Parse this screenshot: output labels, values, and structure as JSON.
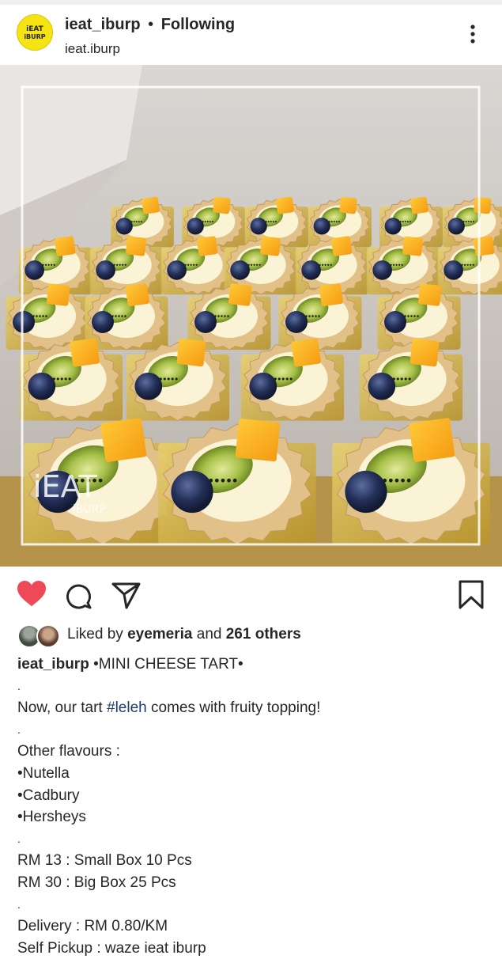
{
  "header": {
    "username": "ieat_iburp",
    "separator": "•",
    "follow_status": "Following",
    "location": "ieat.iburp",
    "avatar_text_line1": "iEAT",
    "avatar_text_line2": "iBURP"
  },
  "photo": {
    "watermark_line1": "iEAT",
    "watermark_line2": "iBURP"
  },
  "actions": {
    "liked": true,
    "like_color": "#ed4956"
  },
  "likes": {
    "prefix": "Liked by",
    "first_liker": "eyemeria",
    "conjunction": "and",
    "others": "261 others"
  },
  "caption": {
    "author": "ieat_iburp",
    "title": "•MINI CHEESE TART•",
    "line1_pre": "Now, our tart",
    "hashtag": "#leleh",
    "line1_post": "comes with fruity topping!",
    "dot": ".",
    "other_flavours": "Other flavours :",
    "flavour1": "•Nutella",
    "flavour2": "•Cadbury",
    "flavour3": "•Hersheys",
    "price1": "RM 13 : Small Box 10 Pcs",
    "price2": "RM 30 : Big Box 25 Pcs",
    "delivery": "Delivery : RM 0.80/KM",
    "pickup": "Self Pickup : waze ieat iburp"
  }
}
